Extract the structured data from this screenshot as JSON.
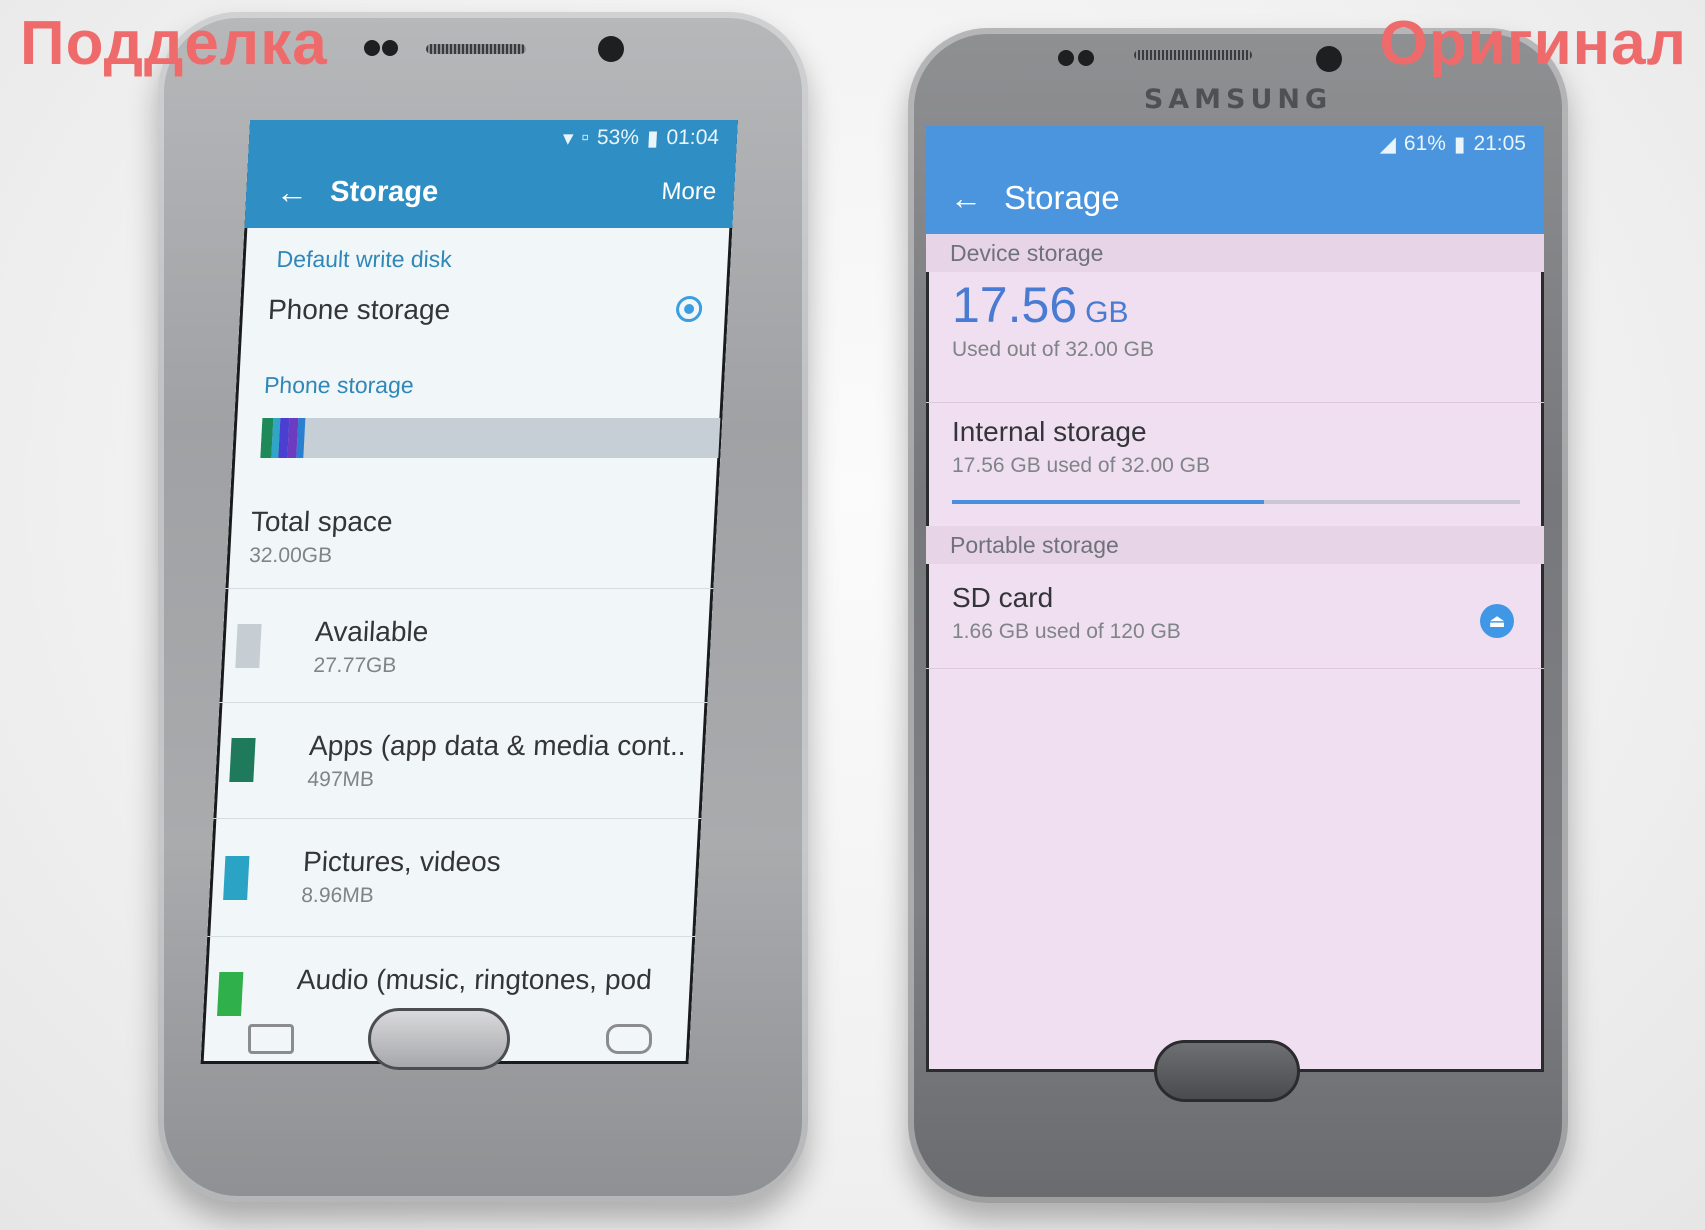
{
  "captions": {
    "fake": "Подделка",
    "original": "Оригинал"
  },
  "fake_phone": {
    "status": {
      "battery": "53%",
      "time": "01:04"
    },
    "app_bar": {
      "title": "Storage",
      "more": "More",
      "back_glyph": "←"
    },
    "default_write_disk_header": "Default write disk",
    "default_write_disk_option": "Phone storage",
    "phone_storage_header": "Phone storage",
    "usage_bar_segments": [
      {
        "color": "#1e8a5a",
        "fraction": 0.025
      },
      {
        "color": "#2fa6c8",
        "fraction": 0.015
      },
      {
        "color": "#4a3fd0",
        "fraction": 0.02
      },
      {
        "color": "#6d3bbf",
        "fraction": 0.02
      },
      {
        "color": "#2a7fd0",
        "fraction": 0.015
      }
    ],
    "total_space": {
      "label": "Total space",
      "value": "32.00GB"
    },
    "items": [
      {
        "label": "Available",
        "value": "27.77GB",
        "color": "#c6cdd3"
      },
      {
        "label": "Apps (app data & media cont..",
        "value": "497MB",
        "color": "#1e7a5a"
      },
      {
        "label": "Pictures, videos",
        "value": "8.96MB",
        "color": "#2aa3c4"
      },
      {
        "label": "Audio (music, ringtones, pod",
        "value": "",
        "color": "#2fb04a"
      }
    ]
  },
  "original_phone": {
    "brand": "SAMSUNG",
    "status": {
      "battery": "61%",
      "time": "21:05"
    },
    "app_bar": {
      "title": "Storage",
      "back_glyph": "←"
    },
    "device_storage_header": "Device storage",
    "used_value": "17.56",
    "used_unit": "GB",
    "used_out_of": "Used out of 32.00 GB",
    "internal_storage": {
      "label": "Internal storage",
      "sub": "17.56 GB used of 32.00 GB",
      "fraction": 0.55
    },
    "portable_storage_header": "Portable storage",
    "sd_card": {
      "label": "SD card",
      "sub": "1.66 GB used of 120 GB"
    }
  }
}
